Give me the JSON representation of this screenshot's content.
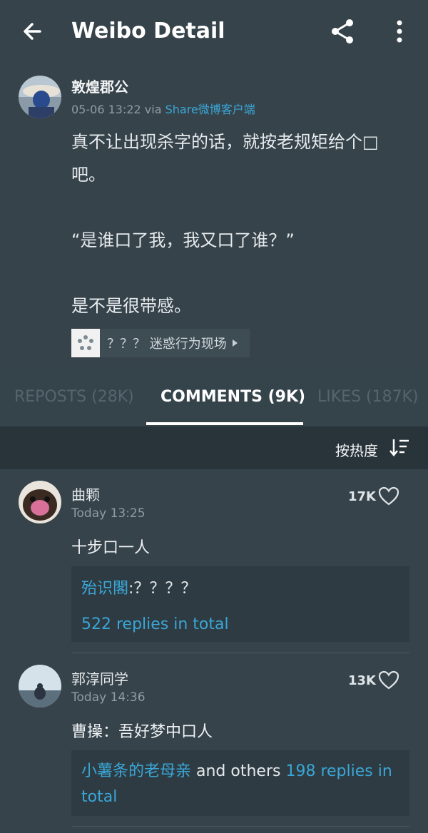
{
  "appbar": {
    "title": "Weibo Detail"
  },
  "post": {
    "author": "敦煌郡公",
    "date": "05-06 13:22",
    "via_prefix": "via",
    "via_source": "Share微博客户端",
    "body_lines": [
      "真不让出现杀字的话，就按老规矩给个□",
      "吧。",
      "",
      "“是谁口了我，我又口了谁？”",
      "",
      "是不是很带感。"
    ],
    "topic_label": "？？？ 迷惑行为现场"
  },
  "tabs": {
    "reposts": "REPOSTS (28K)",
    "comments": "COMMENTS (9K)",
    "likes": "LIKES (187K)"
  },
  "sort": {
    "label": "按热度"
  },
  "comments": [
    {
      "name": "曲颗",
      "time": "Today 13:25",
      "likes": "17K",
      "text": "十步口一人",
      "reply_user": "殆识閣",
      "reply_text": ":？？？？",
      "reply_total": "522 replies in total"
    },
    {
      "name": "郭淳同学",
      "time": "Today 14:36",
      "likes": "13K",
      "text": "曹操：吾好梦中口人",
      "reply_user": "小薯条的老母亲",
      "reply_mid": " and others ",
      "reply_total": "198 replies in total"
    }
  ],
  "colors": {
    "background": "#36434b",
    "link": "#3aa6d6",
    "sortbar": "#29343a"
  }
}
